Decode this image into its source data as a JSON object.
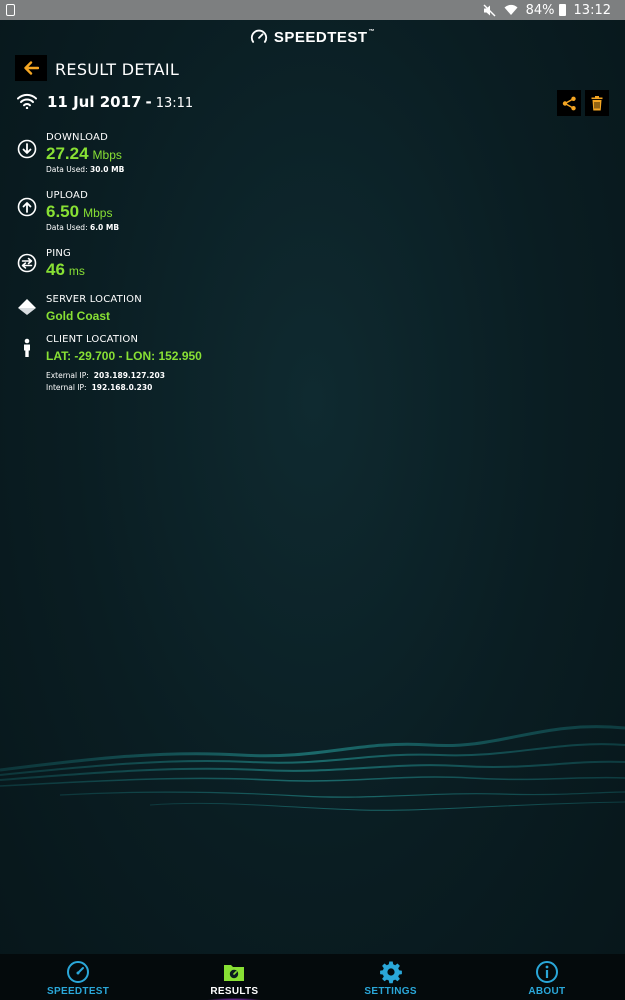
{
  "status_bar": {
    "battery": "84%",
    "time": "13:12"
  },
  "app": {
    "brand": "SPEEDTEST",
    "trademark": "™"
  },
  "header": {
    "title": "RESULT DETAIL"
  },
  "result": {
    "date": "11 Jul 2017",
    "separator": "-",
    "time": "13:11"
  },
  "download": {
    "label": "DOWNLOAD",
    "value": "27.24",
    "unit": "Mbps",
    "data_used_label": "Data Used:",
    "data_used": "30.0 MB"
  },
  "upload": {
    "label": "UPLOAD",
    "value": "6.50",
    "unit": "Mbps",
    "data_used_label": "Data Used:",
    "data_used": "6.0 MB"
  },
  "ping": {
    "label": "PING",
    "value": "46",
    "unit": "ms"
  },
  "server": {
    "label": "SERVER LOCATION",
    "value": "Gold Coast"
  },
  "client": {
    "label": "CLIENT LOCATION",
    "coords": "LAT: -29.700 - LON: 152.950",
    "external_ip_label": "External IP:",
    "external_ip": "203.189.127.203",
    "internal_ip_label": "Internal IP:",
    "internal_ip": "192.168.0.230"
  },
  "nav": {
    "items": [
      {
        "label": "SPEEDTEST",
        "icon": "speedometer-icon"
      },
      {
        "label": "RESULTS",
        "icon": "results-folder-icon"
      },
      {
        "label": "SETTINGS",
        "icon": "gear-icon"
      },
      {
        "label": "ABOUT",
        "icon": "info-icon"
      }
    ],
    "active": "RESULTS"
  },
  "colors": {
    "accent_green": "#88e034",
    "accent_orange": "#f5a623",
    "nav_blue": "#2aa7d9",
    "active_glow": "#d35cff",
    "background": "#0b1c20"
  }
}
